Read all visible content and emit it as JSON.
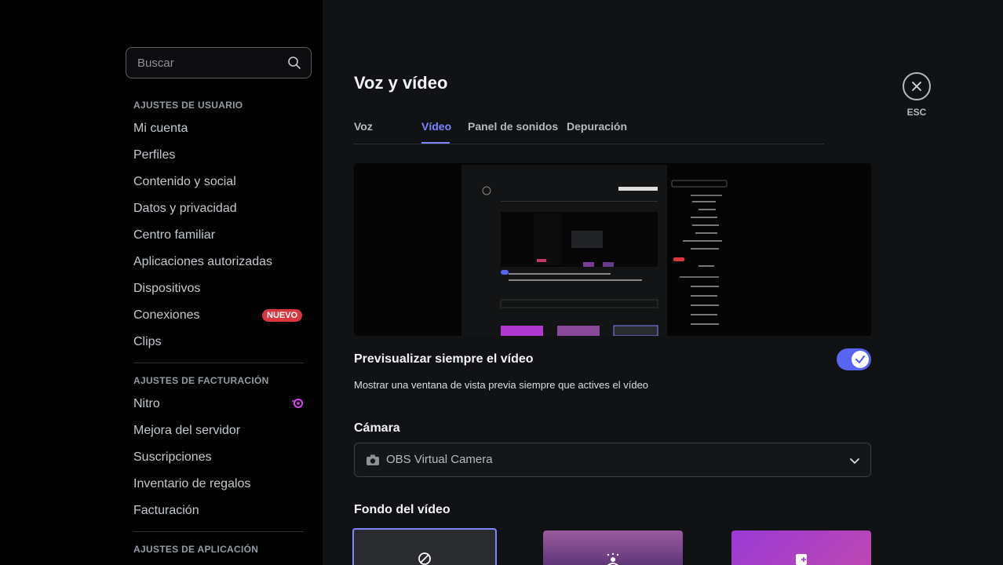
{
  "search": {
    "placeholder": "Buscar"
  },
  "sidebar": {
    "user_settings": {
      "title": "AJUSTES DE USUARIO",
      "items": [
        "Mi cuenta",
        "Perfiles",
        "Contenido y social",
        "Datos y privacidad",
        "Centro familiar",
        "Aplicaciones autorizadas",
        "Dispositivos",
        "Conexiones",
        "Clips"
      ],
      "new_badge": "NUEVO"
    },
    "billing_settings": {
      "title": "AJUSTES DE FACTURACIÓN",
      "items": [
        "Nitro",
        "Mejora del servidor",
        "Suscripciones",
        "Inventario de regalos",
        "Facturación"
      ]
    },
    "app_settings": {
      "title": "AJUSTES DE APLICACIÓN"
    }
  },
  "main": {
    "title": "Voz y vídeo",
    "tabs": [
      {
        "label": "Voz",
        "active": false
      },
      {
        "label": "Vídeo",
        "active": true
      },
      {
        "label": "Panel de sonidos",
        "active": false
      },
      {
        "label": "Depuración",
        "active": false
      }
    ],
    "close": {
      "label": "ESC",
      "icon": "close-icon"
    },
    "always_preview": {
      "label": "Previsualizar siempre el vídeo",
      "description": "Mostrar una ventana de vista previa siempre que actives el vídeo",
      "enabled": true
    },
    "camera": {
      "label": "Cámara",
      "value": "OBS Virtual Camera"
    },
    "video_background": {
      "label": "Fondo del vídeo"
    }
  },
  "colors": {
    "accent": "#5865f2",
    "active_tab": "#7d85ff",
    "badge": "#da373c"
  }
}
